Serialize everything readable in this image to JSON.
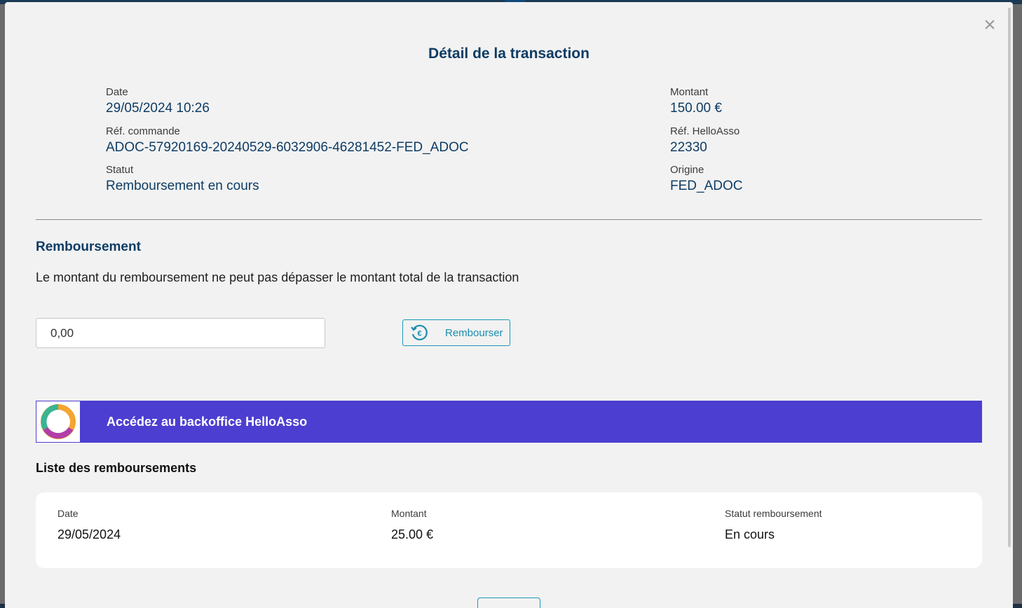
{
  "modal": {
    "title": "Détail de la transaction",
    "close_symbol": "×",
    "transaction": {
      "date_label": "Date",
      "date_value": "29/05/2024 10:26",
      "order_ref_label": "Réf. commande",
      "order_ref_value": "ADOC-57920169-20240529-6032906-46281452-FED_ADOC",
      "status_label": "Statut",
      "status_value": "Remboursement en cours",
      "amount_label": "Montant",
      "amount_value": "150.00 €",
      "helloasso_ref_label": "Réf. HelloAsso",
      "helloasso_ref_value": "22330",
      "origin_label": "Origine",
      "origin_value": "FED_ADOC"
    },
    "refund": {
      "section_title": "Remboursement",
      "info_text": "Le montant du remboursement ne peut pas dépasser le montant total de la transaction",
      "amount_input_value": "0,00",
      "refund_button_label": "Rembourser"
    },
    "helloasso_banner": {
      "label": "Accédez au backoffice HelloAsso"
    },
    "refund_list": {
      "title": "Liste des remboursements",
      "headers": {
        "date": "Date",
        "amount": "Montant",
        "status": "Statut remboursement"
      },
      "rows": [
        {
          "date": "29/05/2024",
          "amount": "25.00 €",
          "status": "En cours"
        }
      ]
    }
  },
  "colors": {
    "primary_blue": "#0f3c64",
    "helloasso_purple": "#4c3ed0",
    "button_teal": "#1a98b8"
  }
}
